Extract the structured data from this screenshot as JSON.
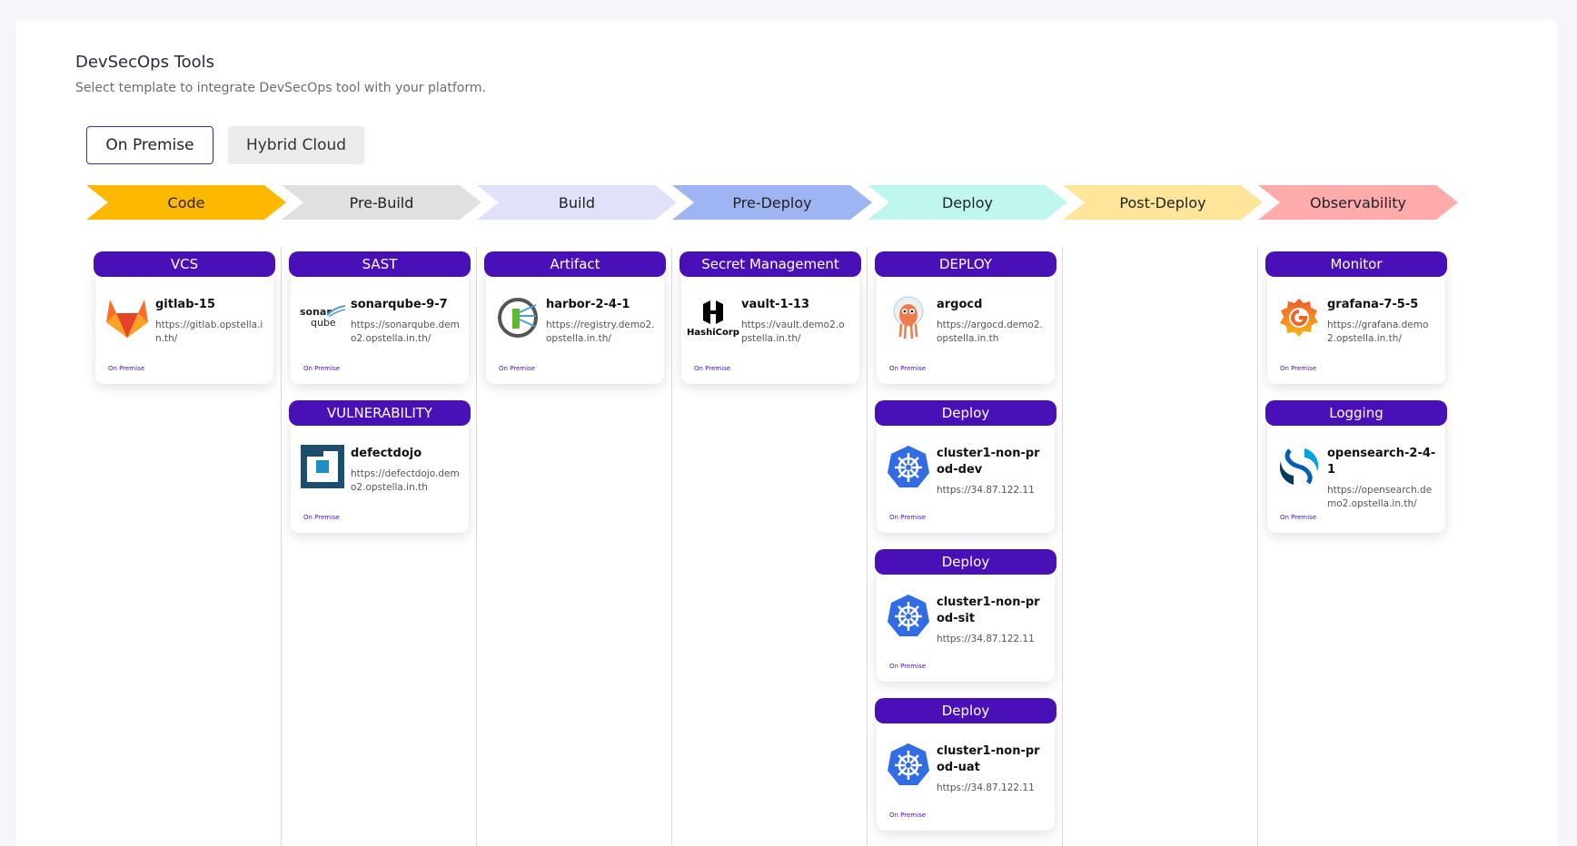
{
  "header": {
    "title": "DevSecOps Tools",
    "subtitle": "Select template to integrate DevSecOps tool with your platform."
  },
  "tabs": {
    "on_premise": "On Premise",
    "hybrid_cloud": "Hybrid Cloud"
  },
  "stages": [
    {
      "label": "Code",
      "color": "#ffb800"
    },
    {
      "label": "Pre-Build",
      "color": "#e0e0e0"
    },
    {
      "label": "Build",
      "color": "#e1e2fa"
    },
    {
      "label": "Pre-Deploy",
      "color": "#9fb4f2"
    },
    {
      "label": "Deploy",
      "color": "#bff7ef"
    },
    {
      "label": "Post-Deploy",
      "color": "#ffe59a"
    },
    {
      "label": "Observability",
      "color": "#ffabab"
    }
  ],
  "cards": [
    {
      "category": "VCS",
      "name": "gitlab-15",
      "url": "https://gitlab.opstella.in.th/",
      "env": "On Premise",
      "icon": "gitlab-icon"
    },
    {
      "category": "SAST",
      "name": "sonarqube-9-7",
      "url": "https://sonarqube.demo2.opstella.in.th/",
      "env": "On Premise",
      "icon": "sonarqube-icon",
      "logo_text_1": "sonar",
      "logo_text_2": "qube"
    },
    {
      "category": "VULNERABILITY",
      "name": "defectdojo",
      "url": "https://defectdojo.demo2.opstella.in.th",
      "env": "On Premise",
      "icon": "defectdojo-icon"
    },
    {
      "category": "Artifact",
      "name": "harbor-2-4-1",
      "url": "https://registry.demo2.opstella.in.th/",
      "env": "On Premise",
      "icon": "harbor-icon"
    },
    {
      "category": "Secret Management",
      "name": "vault-1-13",
      "url": "https://vault.demo2.opstella.in.th/",
      "env": "On Premise",
      "icon": "hashicorp-icon",
      "logo_text": "HashiCorp"
    },
    {
      "category": "DEPLOY",
      "name": "argocd",
      "url": "https://argocd.demo2.opstella.in.th",
      "env": "On Premise",
      "icon": "argocd-icon"
    },
    {
      "category": "Deploy",
      "name": "cluster1-non-prod-dev",
      "url": "https://34.87.122.11",
      "env": "On Premise",
      "icon": "kubernetes-icon"
    },
    {
      "category": "Deploy",
      "name": "cluster1-non-prod-sit",
      "url": "https://34.87.122.11",
      "env": "On Premise",
      "icon": "kubernetes-icon"
    },
    {
      "category": "Deploy",
      "name": "cluster1-non-prod-uat",
      "url": "https://34.87.122.11",
      "env": "On Premise",
      "icon": "kubernetes-icon"
    },
    {
      "category": "Monitor",
      "name": "grafana-7-5-5",
      "url": "https://grafana.demo2.opstella.in.th/",
      "env": "On Premise",
      "icon": "grafana-icon"
    },
    {
      "category": "Logging",
      "name": "opensearch-2-4-1",
      "url": "https://opensearch.demo2.opstella.in.th/",
      "env": "On Premise",
      "icon": "opensearch-icon"
    }
  ],
  "colors": {
    "accent": "#4a10b8",
    "tab_border": "#4a22b5"
  }
}
